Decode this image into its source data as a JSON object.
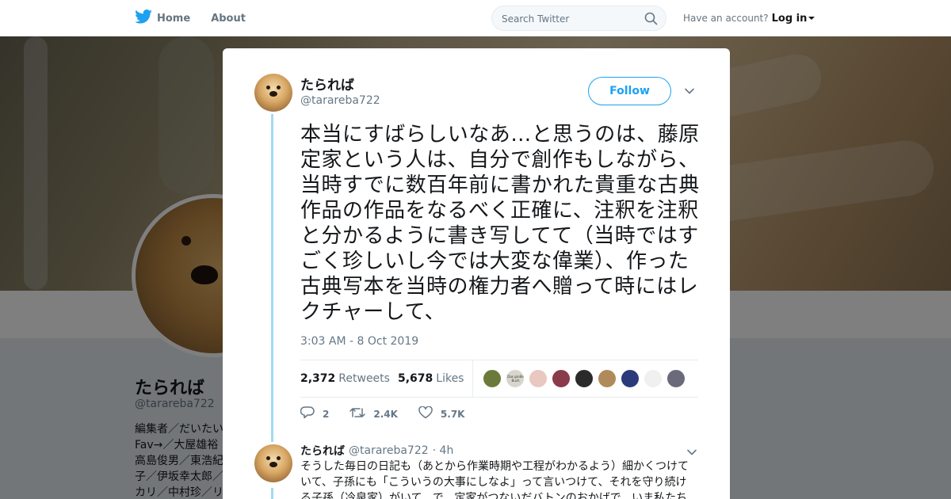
{
  "nav": {
    "home_label": "Home",
    "about_label": "About",
    "search_placeholder": "Search Twitter",
    "have_account": "Have an account?",
    "login_label": "Log in"
  },
  "profile": {
    "name": "たられば",
    "handle": "@tarareba722",
    "bio": "編集者／だいたい Fav→／大屋雄裕 高島俊男／東浩紀 子／伊坂幸太郎／ カリ／中村珍／リ"
  },
  "tweet": {
    "author_name": "たられば",
    "author_handle": "@tarareba722",
    "follow_label": "Follow",
    "text": "本当にすばらしいなあ…と思うのは、藤原定家という人は、自分で創作もしながら、当時すでに数百年前に書かれた貴重な古典作品の作品をなるべく正確に、注釈を注釈と分かるように書き写してて（当時ではすごく珍しいし今では大変な偉業）、作った古典写本を当時の権力者へ贈って時にはレクチャーして、",
    "timestamp": "3:03 AM - 8 Oct 2019",
    "retweets_count": "2,372",
    "retweets_label": "Retweets",
    "likes_count": "5,678",
    "likes_label": "Likes",
    "reply_count": "2",
    "retweet_action_count": "2.4K",
    "like_action_count": "5.7K"
  },
  "likers": [
    {
      "color": "#6b7a3a"
    },
    {
      "color": "#d8d6cc"
    },
    {
      "color": "#e8c8c0"
    },
    {
      "color": "#8a3a4a"
    },
    {
      "color": "#2a2a2a"
    },
    {
      "color": "#b08a5a"
    },
    {
      "color": "#2a3a7a"
    },
    {
      "color": "#f0f0f0"
    },
    {
      "color": "#6a6a7a"
    }
  ],
  "liker_avatar_2_text": "Das große Buch",
  "reply": {
    "author_name": "たられば",
    "author_handle": "@tarareba722",
    "age": "· 4h",
    "text": "そうした毎日の日記も（あとから作業時期や工程がわかるよう）細かくつけていて、子孫にも「こういうの大事にしなよ」って言いつけて、それを守り続ける子孫（冷泉家）がいて、で、定家がつないだバトンのおかげで、いま私たち"
  },
  "colors": {
    "twitter_blue": "#1da1f2",
    "thread_line": "#a4d9f3",
    "text_primary": "#14171a",
    "text_secondary": "#657786"
  }
}
